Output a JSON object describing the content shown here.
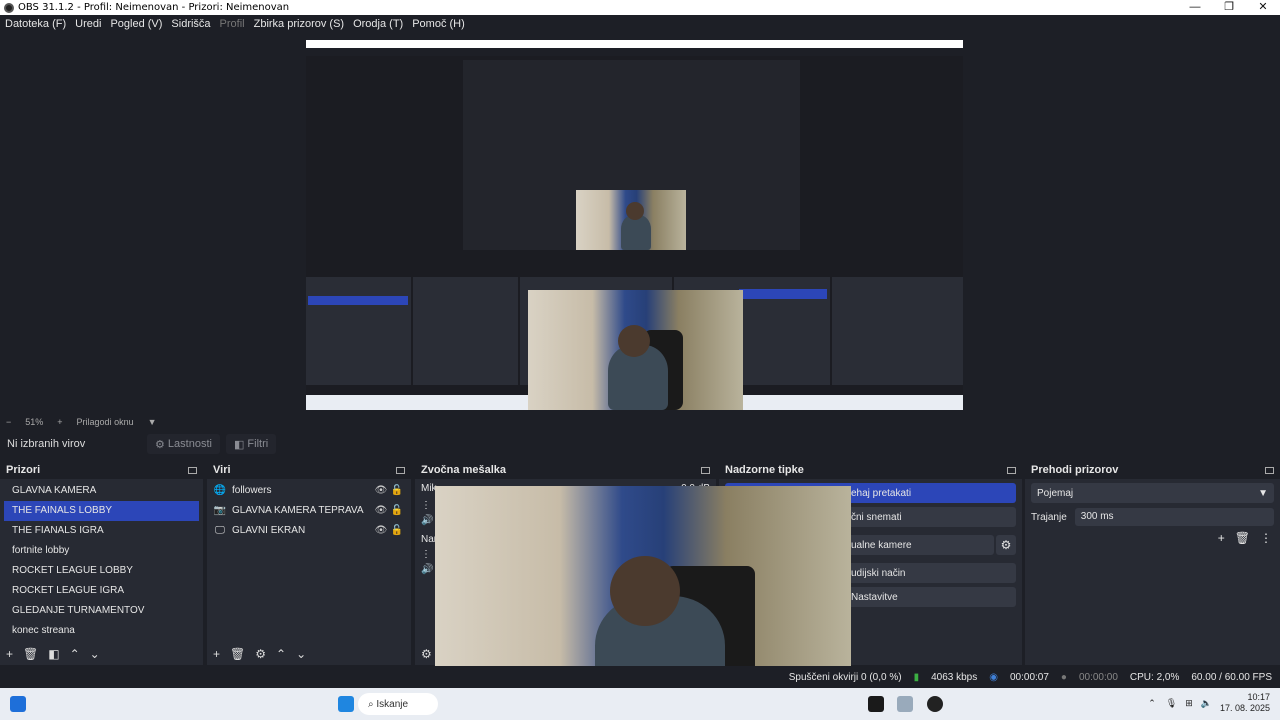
{
  "window": {
    "title": "OBS 31.1.2 - Profil: Neimenovan - Prizori: Neimenovan",
    "controls": [
      "—",
      "❐",
      "✕"
    ]
  },
  "menu": {
    "file": "Datoteka (F)",
    "edit": "Uredi",
    "view": "Pogled (V)",
    "docks": "Sidrišča",
    "profile": "Profil",
    "scene_collection": "Zbirka prizorov (S)",
    "tools": "Orodja (T)",
    "help": "Pomoč (H)"
  },
  "zoom": {
    "value": "51%",
    "fit": "Prilagodi oknu"
  },
  "sourcebar": {
    "no_selection": "Ni izbranih virov",
    "properties": "Lastnosti",
    "filters": "Filtri"
  },
  "scenes": {
    "title": "Prizori",
    "items": [
      "GLAVNA KAMERA",
      "THE FAINALS LOBBY",
      "THE FIANALS IGRA",
      "fortnite lobby",
      "ROCKET LEAGUE LOBBY",
      "ROCKET LEAGUE IGRA",
      "GLEDANJE TURNAMENTOV",
      "konec streana"
    ],
    "selected_index": 1
  },
  "sources": {
    "title": "Viri",
    "items": [
      {
        "label": "followers",
        "icon": "globe-icon"
      },
      {
        "label": "GLAVNA KAMERA TEPRAVA",
        "icon": "camera-icon"
      },
      {
        "label": "GLAVNI EKRAN",
        "icon": "monitor-icon"
      }
    ]
  },
  "mixer": {
    "title": "Zvočna mešalka",
    "track1_label": "Mik",
    "track1_db": "0.0 dB",
    "track2_label": "Nam"
  },
  "controls": {
    "title": "Nadzorne tipke",
    "start_stream": "ehaj pretakati",
    "start_record": "čni snemati",
    "virtual_cam": "ualne kamere",
    "studio_mode": "udijski način",
    "settings": "Nastavitve"
  },
  "transitions": {
    "title": "Prehodi prizorov",
    "type": "Pojemaj",
    "duration_label": "Trajanje",
    "duration": "300 ms"
  },
  "status": {
    "dropped": "Spuščeni okvirji 0 (0,0 %)",
    "bitrate": "4063 kbps",
    "stream_time": "00:00:07",
    "rec_time": "00:00:00",
    "cpu": "CPU: 2,0%",
    "fps": "60.00 / 60.00 FPS"
  },
  "taskbar": {
    "search": "Iskanje",
    "time": "10:17",
    "date": "17. 08. 2025"
  },
  "colors": {
    "accent": "#2c46b8",
    "bg": "#1d1f26",
    "panel": "#272a33"
  }
}
